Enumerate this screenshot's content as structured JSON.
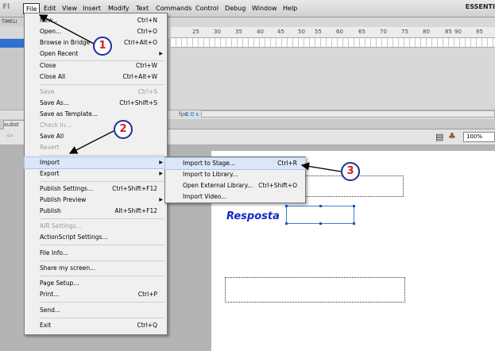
{
  "menubar": {
    "items": [
      "File",
      "Edit",
      "View",
      "Insert",
      "Modify",
      "Text",
      "Commands",
      "Control",
      "Debug",
      "Window",
      "Help"
    ],
    "workspace": "ESSENTI"
  },
  "timeline": {
    "tab": "TIMELI",
    "ticks": [
      "25",
      "30",
      "35",
      "40",
      "45",
      "50",
      "55",
      "60",
      "65",
      "70",
      "75",
      "80",
      "85",
      "90",
      "95"
    ],
    "fps": "fps",
    "time": "0.0 s"
  },
  "document": {
    "tab": "subst",
    "zoom": "100%"
  },
  "stage": {
    "label": "Resposta"
  },
  "file_menu": {
    "items": [
      {
        "label": "New...",
        "shortcut": "Ctrl+N"
      },
      {
        "label": "Open...",
        "shortcut": "Ctrl+O"
      },
      {
        "label": "Browse in Bridge",
        "shortcut": "Ctrl+Alt+O"
      },
      {
        "label": "Open Recent",
        "shortcut": ""
      },
      {
        "label": "Close",
        "shortcut": "Ctrl+W"
      },
      {
        "label": "Close All",
        "shortcut": "Ctrl+Alt+W"
      },
      {
        "label": "Save",
        "shortcut": "Ctrl+S"
      },
      {
        "label": "Save As...",
        "shortcut": "Ctrl+Shift+S"
      },
      {
        "label": "Save as Template...",
        "shortcut": ""
      },
      {
        "label": "Check In...",
        "shortcut": ""
      },
      {
        "label": "Save All",
        "shortcut": ""
      },
      {
        "label": "Revert",
        "shortcut": ""
      },
      {
        "label": "Import",
        "shortcut": ""
      },
      {
        "label": "Export",
        "shortcut": ""
      },
      {
        "label": "Publish Settings...",
        "shortcut": "Ctrl+Shift+F12"
      },
      {
        "label": "Publish Preview",
        "shortcut": ""
      },
      {
        "label": "Publish",
        "shortcut": "Alt+Shift+F12"
      },
      {
        "label": "AIR Settings...",
        "shortcut": ""
      },
      {
        "label": "ActionScript Settings...",
        "shortcut": ""
      },
      {
        "label": "File Info...",
        "shortcut": ""
      },
      {
        "label": "Share my screen...",
        "shortcut": ""
      },
      {
        "label": "Page Setup...",
        "shortcut": ""
      },
      {
        "label": "Print...",
        "shortcut": "Ctrl+P"
      },
      {
        "label": "Send...",
        "shortcut": ""
      },
      {
        "label": "Exit",
        "shortcut": "Ctrl+Q"
      }
    ]
  },
  "import_submenu": {
    "items": [
      {
        "label": "Import to Stage...",
        "shortcut": "Ctrl+R"
      },
      {
        "label": "Import to Library...",
        "shortcut": ""
      },
      {
        "label": "Open External Library...",
        "shortcut": "Ctrl+Shift+O"
      },
      {
        "label": "Import Video...",
        "shortcut": ""
      }
    ]
  },
  "annotations": [
    "1",
    "2",
    "3"
  ],
  "colors": {
    "badge_border": "#1d2d9a",
    "badge_number": "#d42020",
    "stage_label": "#1428c8",
    "selection": "#3b7fd6"
  },
  "icons": [
    "app-logo-icon",
    "back-arrow-icon",
    "edit-scene-icon",
    "edit-symbol-icon",
    "submenu-arrow-icon"
  ]
}
